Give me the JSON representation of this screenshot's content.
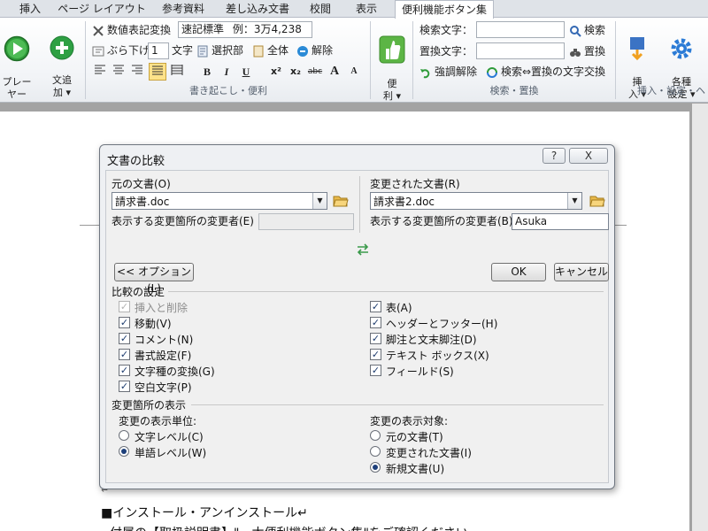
{
  "tabs": [
    "挿入",
    "ページ レイアウト",
    "参考資料",
    "差し込み文書",
    "校閲",
    "表示",
    "便利機能ボタン集"
  ],
  "ribbon": {
    "player_label": "プレー\nヤー",
    "add_label": "文追\n加 ▾",
    "number_convert": "数値表記変換",
    "number_mode": "速記標準",
    "number_example": "例：3万4,238",
    "hang_label": "ぶら下げ",
    "hang_value": "1",
    "hang_unit": "文字",
    "select_part": "選択部",
    "all": "全体",
    "release": "解除",
    "fmt_bold": "B",
    "fmt_italic": "I",
    "fmt_underline": "U",
    "fmt_sup": "x²",
    "fmt_sub": "x₂",
    "fmt_strike": "abc",
    "fmt_grow": "A",
    "fmt_shrink": "A",
    "group1_label": "書き起こし・便利",
    "benri_label": "便\n利 ▾",
    "search_label": "検索文字：",
    "replace_label": "置換文字：",
    "search_btn": "検索",
    "replace_btn": "置換",
    "highlight_release": "強調解除",
    "swap_label": "検索⇔置換の文字交換",
    "group2_label": "検索・置換",
    "insert_label": "挿\n入 ▾",
    "settings_label": "各種\n設定 ▾",
    "group3_label": "挿入・設定・ヘ"
  },
  "document": {
    "heading": "■インストール・アンインストール↵",
    "line2": "付属の【取扱説明書】\"一太便利機能ボタン集\"をご確認ください。",
    "para_mark": "↵"
  },
  "dialog": {
    "title": "文書の比較",
    "help": "?",
    "close": "X",
    "original_label": "元の文書(O)",
    "original_value": "請求書.doc",
    "original_author_label": "表示する変更箇所の変更者(E)",
    "original_author_value": "",
    "revised_label": "変更された文書(R)",
    "revised_value": "請求書2.doc",
    "revised_author_label": "表示する変更箇所の変更者(B)",
    "revised_author_value": "Asuka",
    "options_btn": "<< オプション(L)",
    "ok_btn": "OK",
    "cancel_btn": "キャンセル",
    "compare_settings": "比較の設定",
    "left_checks": [
      {
        "label": "挿入と削除",
        "checked": true,
        "disabled": true
      },
      {
        "label": "移動(V)",
        "checked": true,
        "disabled": false
      },
      {
        "label": "コメント(N)",
        "checked": true,
        "disabled": false
      },
      {
        "label": "書式設定(F)",
        "checked": true,
        "disabled": false
      },
      {
        "label": "文字種の変換(G)",
        "checked": true,
        "disabled": false
      },
      {
        "label": "空白文字(P)",
        "checked": true,
        "disabled": false
      }
    ],
    "right_checks": [
      {
        "label": "表(A)",
        "checked": true
      },
      {
        "label": "ヘッダーとフッター(H)",
        "checked": true
      },
      {
        "label": "脚注と文末脚注(D)",
        "checked": true
      },
      {
        "label": "テキスト ボックス(X)",
        "checked": true
      },
      {
        "label": "フィールド(S)",
        "checked": true
      }
    ],
    "show_changes": "変更箇所の表示",
    "unit_label": "変更の表示単位:",
    "unit_options": [
      {
        "label": "文字レベル(C)",
        "selected": false
      },
      {
        "label": "単語レベル(W)",
        "selected": true
      }
    ],
    "target_label": "変更の表示対象:",
    "target_options": [
      {
        "label": "元の文書(T)",
        "selected": false
      },
      {
        "label": "変更された文書(I)",
        "selected": false
      },
      {
        "label": "新規文書(U)",
        "selected": true
      }
    ]
  }
}
